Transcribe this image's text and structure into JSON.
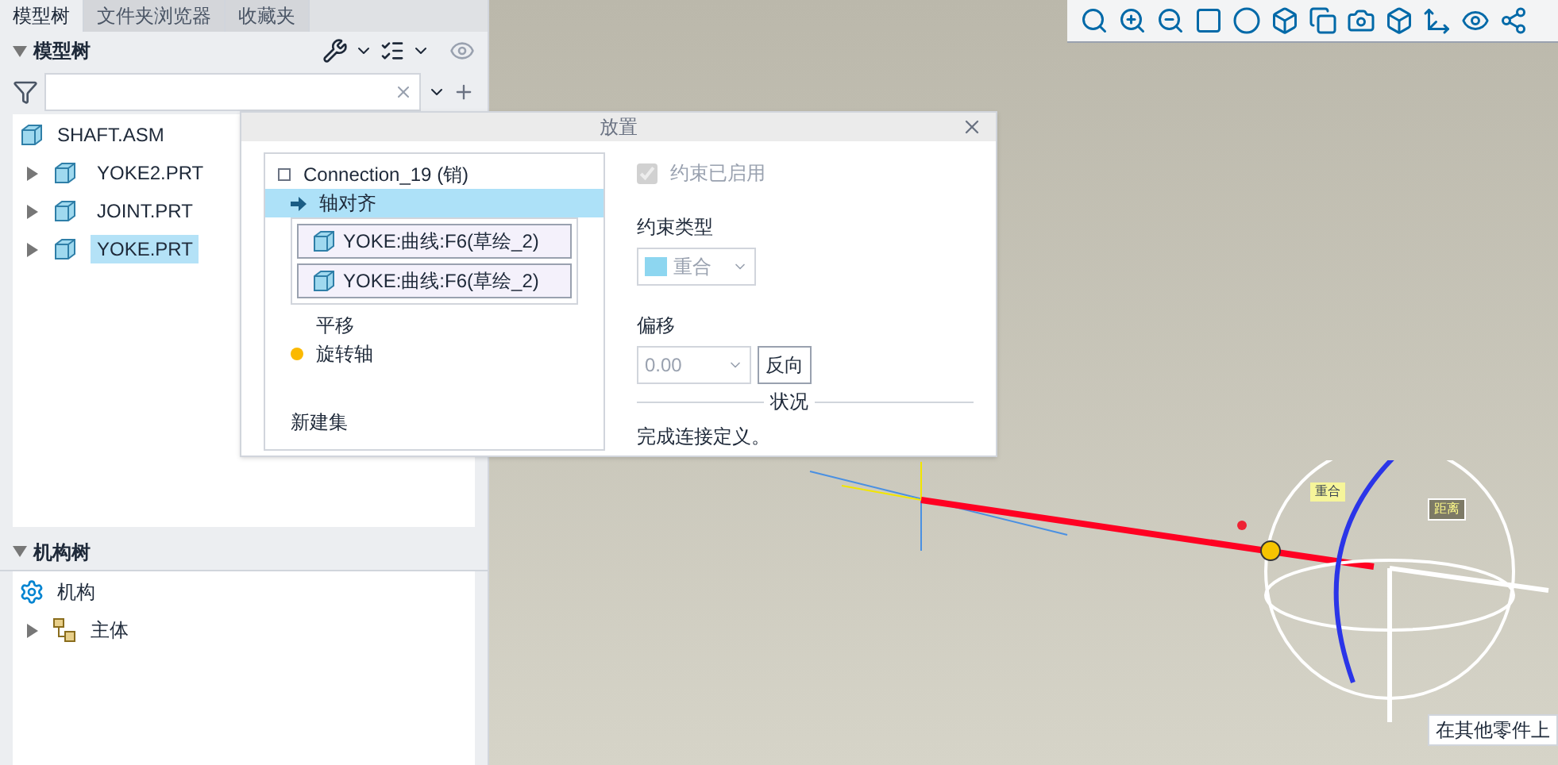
{
  "tabs": [
    {
      "label": "模型树",
      "selected": true
    },
    {
      "label": "文件夹浏览器",
      "selected": false
    },
    {
      "label": "收藏夹",
      "selected": false
    }
  ],
  "model_tree": {
    "title": "模型树",
    "expanded": true,
    "root": "SHAFT.ASM",
    "items": [
      {
        "label": "YOKE2.PRT",
        "selected": false
      },
      {
        "label": "JOINT.PRT",
        "selected": false
      },
      {
        "label": "YOKE.PRT",
        "selected": true
      }
    ]
  },
  "mechanism_tree": {
    "title": "机构树",
    "expanded": true,
    "root": "机构",
    "items": [
      {
        "label": "主体"
      }
    ]
  },
  "dialog": {
    "title": "放置",
    "connection": "Connection_19 (销)",
    "constraints": [
      {
        "label": "轴对齐",
        "selected": true,
        "incomplete": false,
        "references": [
          "YOKE:曲线:F6(草绘_2)",
          "YOKE:曲线:F6(草绘_2)"
        ]
      },
      {
        "label": "平移",
        "selected": false,
        "incomplete": false
      },
      {
        "label": "旋转轴",
        "selected": false,
        "incomplete": true
      }
    ],
    "new_set": "新建集",
    "enabled": {
      "label": "约束已启用",
      "checked": true,
      "disabled": true
    },
    "type_label": "约束类型",
    "type_value": "重合",
    "offset_label": "偏移",
    "offset_value": "0.00",
    "flip_button": "反向",
    "status_label": "状况",
    "status_text": "完成连接定义。"
  },
  "viewport": {
    "tags": [
      "重合",
      "距离"
    ],
    "tooltip": "在其他零件上"
  }
}
